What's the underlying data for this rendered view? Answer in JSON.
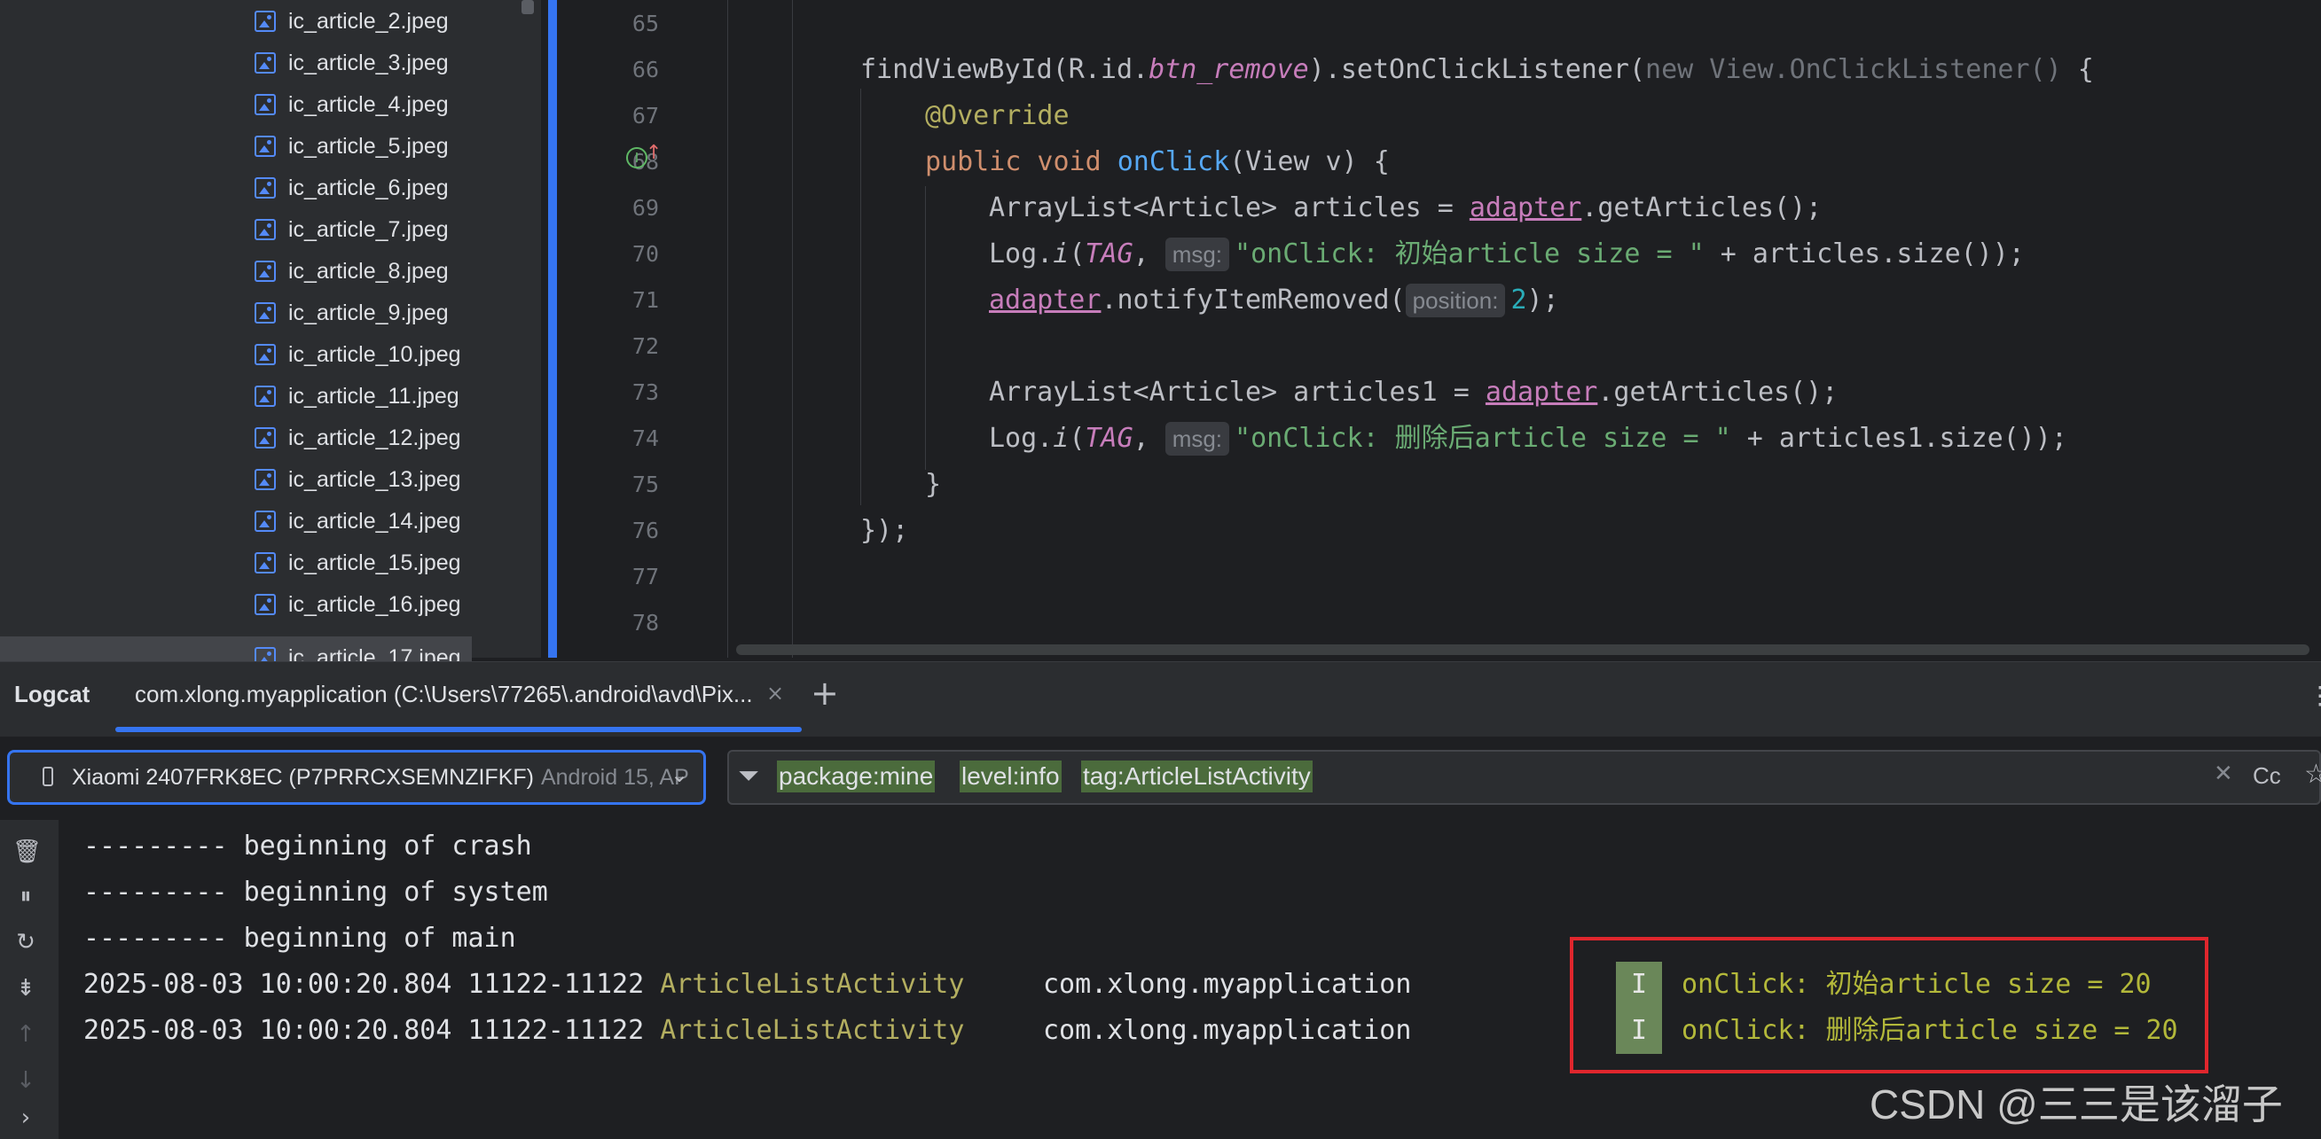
{
  "project_tree": {
    "files": [
      "ic_article_2.jpeg",
      "ic_article_3.jpeg",
      "ic_article_4.jpeg",
      "ic_article_5.jpeg",
      "ic_article_6.jpeg",
      "ic_article_7.jpeg",
      "ic_article_8.jpeg",
      "ic_article_9.jpeg",
      "ic_article_10.jpeg",
      "ic_article_11.jpeg",
      "ic_article_12.jpeg",
      "ic_article_13.jpeg",
      "ic_article_14.jpeg",
      "ic_article_15.jpeg",
      "ic_article_16.jpeg",
      "ic_article_17.jpeg"
    ]
  },
  "editor": {
    "line_numbers": [
      "65",
      "66",
      "67",
      "68",
      "69",
      "70",
      "71",
      "72",
      "73",
      "74",
      "75",
      "76",
      "77",
      "78"
    ],
    "code": {
      "l66": {
        "a": "findViewById(R.id.",
        "b": "btn_remove",
        "c": ").setOnClickListener(",
        "d": "new View.OnClickListener()",
        "e": " {"
      },
      "l67": {
        "a": "@Override"
      },
      "l68": {
        "a": "public void ",
        "b": "onClick",
        "c": "(View v) {"
      },
      "l69": {
        "a": "ArrayList<Article> articles = ",
        "b": "adapter",
        "c": ".getArticles();"
      },
      "l70": {
        "a": "Log.",
        "b": "i",
        "c": "(",
        "d": "TAG",
        "e": ", ",
        "hint": "msg:",
        "f": "\"onClick: 初始article size = \"",
        "g": " + articles.size());"
      },
      "l71": {
        "a": "adapter",
        "b": ".notifyItemRemoved(",
        "hint": "position:",
        "c": "2",
        "d": ");"
      },
      "l73": {
        "a": "ArrayList<Article> articles1 = ",
        "b": "adapter",
        "c": ".getArticles();"
      },
      "l74": {
        "a": "Log.",
        "b": "i",
        "c": "(",
        "d": "TAG",
        "e": ", ",
        "hint": "msg:",
        "f": "\"onClick: 删除后article size = \"",
        "g": " + articles1.size());"
      },
      "l75": {
        "a": "}"
      },
      "l76": {
        "a": "});"
      }
    }
  },
  "logcat": {
    "title": "Logcat",
    "tab_label": "com.xlong.myapplication (C:\\Users\\77265\\.android\\avd\\Pix...",
    "tab_close": "×",
    "add_tab": "+",
    "device": {
      "name": "Xiaomi 2407FRK8EC (P7PRRCXSEMNZIFKF)",
      "sub": "Android 15, AP"
    },
    "filter_chips": [
      "package:mine",
      "level:info",
      "tag:ArticleListActivity"
    ],
    "filter_case": "Cc",
    "lines": [
      "--------- beginning of crash",
      "--------- beginning of system",
      "--------- beginning of main"
    ],
    "entries": [
      {
        "time": "2025-08-03 10:00:20.804 11122-11122",
        "tag": "ArticleListActivity",
        "pkg": "com.xlong.myapplication",
        "level": "I",
        "msg": "onClick: 初始article size = 20"
      },
      {
        "time": "2025-08-03 10:00:20.804 11122-11122",
        "tag": "ArticleListActivity",
        "pkg": "com.xlong.myapplication",
        "level": "I",
        "msg": "onClick: 删除后article size = 20"
      }
    ]
  },
  "watermark": "CSDN @三三是该溜子",
  "colors": {
    "accent": "#3574f0",
    "highlight": "#e0262d",
    "chip": "#4b6b3c",
    "level_info": "#6a8759"
  }
}
